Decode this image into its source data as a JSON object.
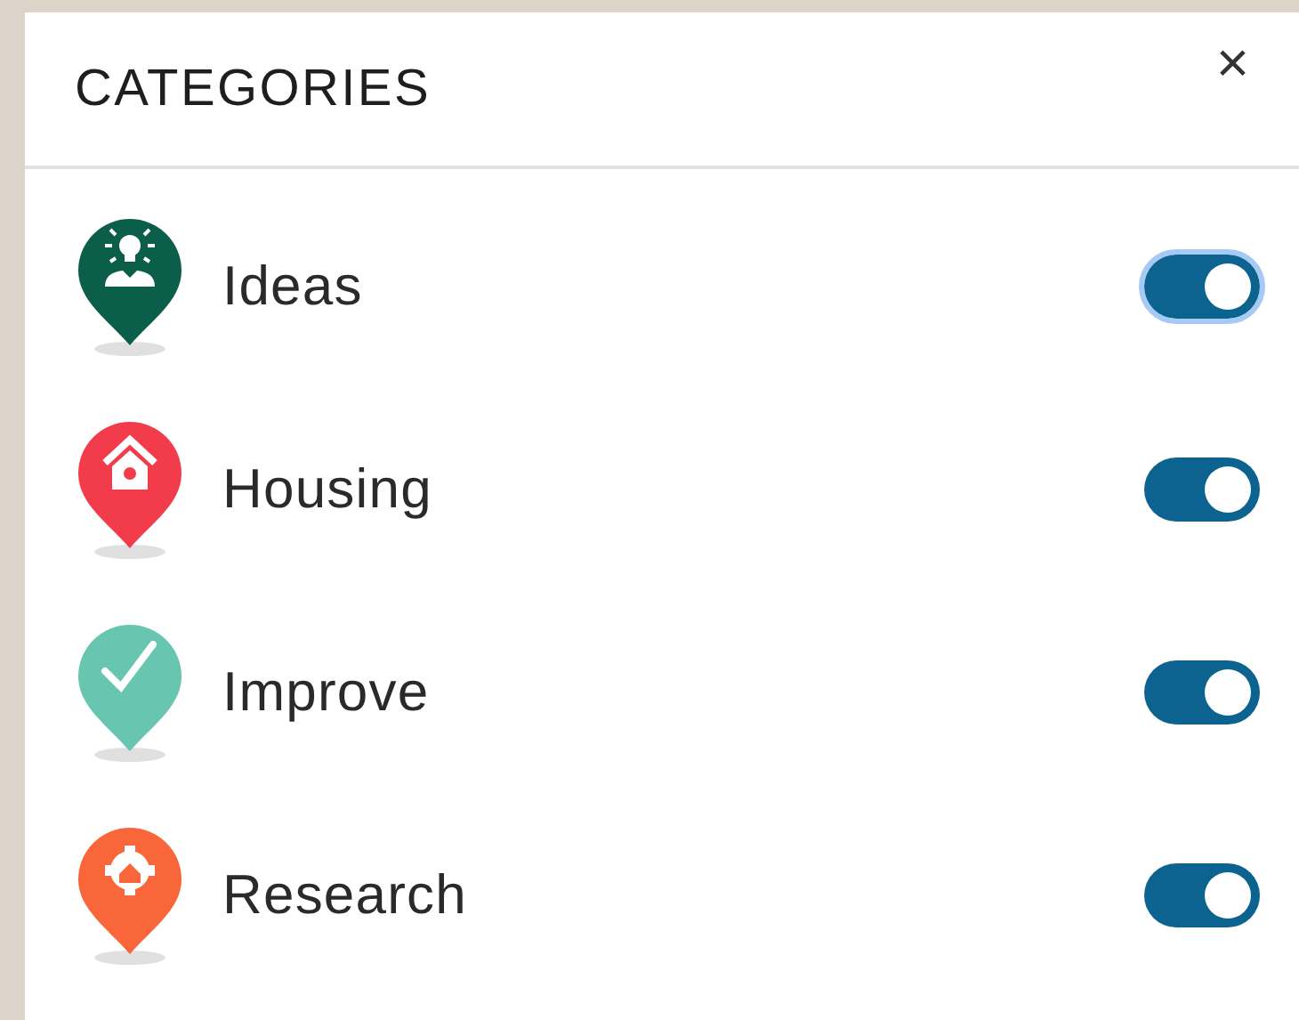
{
  "panel": {
    "title": "CATEGORIES",
    "close": "×"
  },
  "categories": [
    {
      "label": "Ideas",
      "kind": "idea",
      "color": "#0b5e49",
      "on": true,
      "focused": true
    },
    {
      "label": "Housing",
      "kind": "house",
      "color": "#f23c4b",
      "on": true,
      "focused": false
    },
    {
      "label": "Improve",
      "kind": "check",
      "color": "#68c5b0",
      "on": true,
      "focused": false
    },
    {
      "label": "Research",
      "kind": "gear",
      "color": "#f8663a",
      "on": true,
      "focused": false
    }
  ]
}
